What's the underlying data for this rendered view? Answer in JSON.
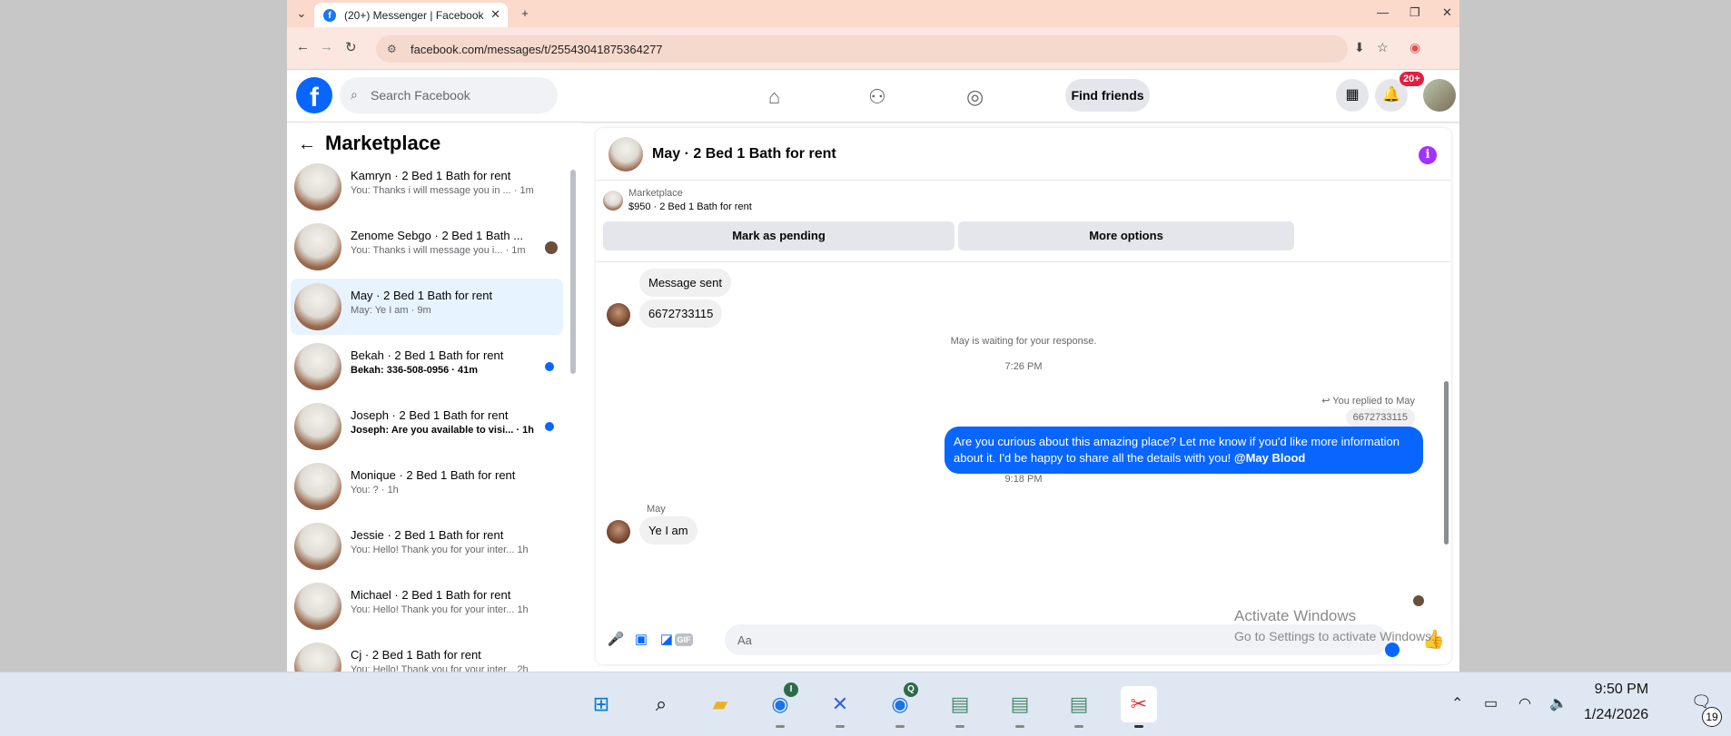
{
  "browser": {
    "tab_title": "(20+) Messenger | Facebook",
    "tab_favicon_glyph": "f",
    "url": "facebook.com/messages/t/25543041875364277"
  },
  "fb_header": {
    "logo_glyph": "f",
    "search_placeholder": "Search Facebook",
    "find_friends_label": "Find friends",
    "notifications_badge": "20+"
  },
  "sidebar": {
    "title": "Marketplace",
    "conversations": [
      {
        "name": "Kamryn · 2 Bed 1 Bath for rent",
        "preview": "You: Thanks i will message you in ... · 1m",
        "unread": false,
        "indicator": "none"
      },
      {
        "name": "Zenome Sebgo · 2 Bed 1 Bath ...",
        "preview": "You: Thanks i will message you i... · 1m",
        "unread": false,
        "indicator": "avatar"
      },
      {
        "name": "May · 2 Bed 1 Bath for rent",
        "preview": "May: Ye I am · 9m",
        "unread": false,
        "indicator": "none",
        "active": true
      },
      {
        "name": "Bekah · 2 Bed 1 Bath for rent",
        "preview": "Bekah: 336-508-0956 · 41m",
        "unread": true,
        "indicator": "dot"
      },
      {
        "name": "Joseph · 2 Bed 1 Bath for rent",
        "preview": "Joseph: Are you available to visi... · 1h",
        "unread": true,
        "indicator": "dot"
      },
      {
        "name": "Monique · 2 Bed 1 Bath for rent",
        "preview": "You: ? · 1h",
        "unread": false,
        "indicator": "none"
      },
      {
        "name": "Jessie · 2 Bed 1 Bath for rent",
        "preview": "You: Hello! Thank you for your inter... 1h",
        "unread": false,
        "indicator": "none"
      },
      {
        "name": "Michael · 2 Bed 1 Bath for rent",
        "preview": "You: Hello! Thank you for your inter... 1h",
        "unread": false,
        "indicator": "none"
      },
      {
        "name": "Cj · 2 Bed 1 Bath for rent",
        "preview": "You: Hello! Thank you for your inter... 2h",
        "unread": false,
        "indicator": "none"
      }
    ]
  },
  "chat": {
    "title": "May · 2 Bed 1 Bath for rent",
    "listing_label": "Marketplace",
    "listing_price": "$950 · 2 Bed 1 Bath for rent",
    "mark_pending_label": "Mark as pending",
    "more_options_label": "More options",
    "messages": {
      "message_sent": "Message sent",
      "phone_message": "6672733115",
      "waiting": "May is waiting for your response.",
      "time1": "7:26 PM",
      "replied_to": "You replied to May",
      "quoted": "6672733115",
      "outgoing_text": "Are you curious about this amazing place? Let me know if you'd like more information about it. I'd be happy to share all the details with you!",
      "outgoing_mention": "@May Blood",
      "time2": "9:18 PM",
      "sender": "May",
      "last_message": "Ye I am"
    },
    "composer_placeholder": "Aa"
  },
  "watermark": {
    "line1": "Activate Windows",
    "line2": "Go to Settings to activate Windows."
  },
  "taskbar": {
    "time": "9:50 PM",
    "date": "1/24/2026",
    "notification_count": "19",
    "chrome1_badge": "I",
    "chrome2_badge": "Q"
  }
}
